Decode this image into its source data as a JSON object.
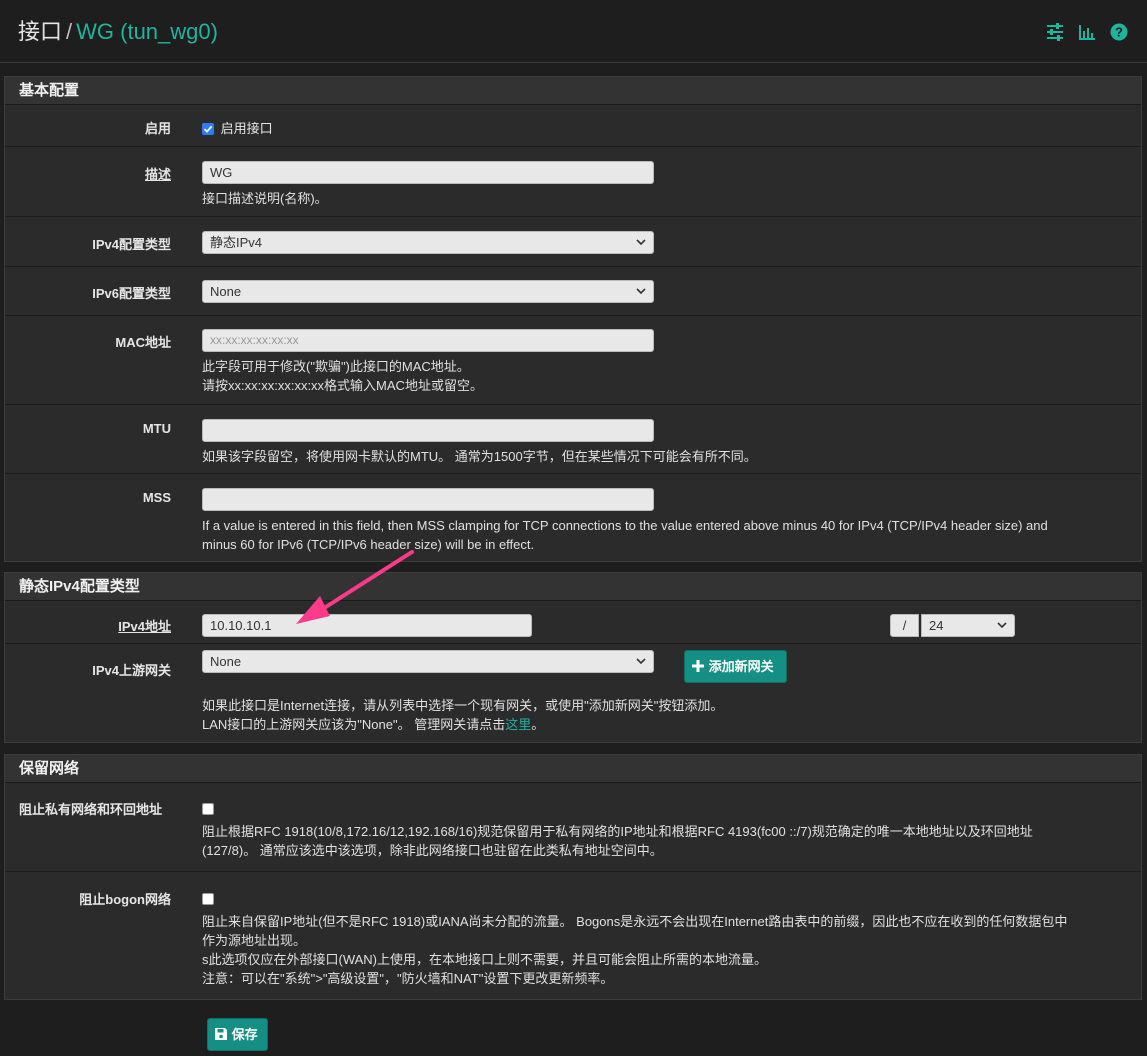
{
  "header": {
    "breadcrumb_root": "接口",
    "breadcrumb_sep": "/",
    "breadcrumb_current": "WG (tun_wg0)",
    "icons": [
      "sliders-icon",
      "bar-chart-icon",
      "help-icon"
    ]
  },
  "basic": {
    "title": "基本配置",
    "enable_label": "启用",
    "enable_checkbox_label": "启用接口",
    "enable_checked": true,
    "desc_label": "描述",
    "desc_value": "WG",
    "desc_help": "接口描述说明(名称)。",
    "ipv4_type_label": "IPv4配置类型",
    "ipv4_type_value": "静态IPv4",
    "ipv6_type_label": "IPv6配置类型",
    "ipv6_type_value": "None",
    "mac_label": "MAC地址",
    "mac_placeholder": "xx:xx:xx:xx:xx:xx",
    "mac_help_1": "此字段可用于修改(\"欺骗\")此接口的MAC地址。",
    "mac_help_2": "请按xx:xx:xx:xx:xx:xx格式输入MAC地址或留空。",
    "mtu_label": "MTU",
    "mtu_help": "如果该字段留空，将使用网卡默认的MTU。 通常为1500字节，但在某些情况下可能会有所不同。",
    "mss_label": "MSS",
    "mss_help_1": "If a value is entered in this field, then MSS clamping for TCP connections to the value entered above minus 40 for IPv4 (TCP/IPv4 header size) and",
    "mss_help_2": "minus 60 for IPv6 (TCP/IPv6 header size) will be in effect."
  },
  "static4": {
    "title": "静态IPv4配置类型",
    "addr_label": "IPv4地址",
    "addr_value": "10.10.10.1",
    "slash": "/",
    "mask_value": "24",
    "gw_label": "IPv4上游网关",
    "gw_value": "None",
    "add_gw_button": "添加新网关",
    "gw_help_1": "如果此接口是Internet连接，请从列表中选择一个现有网关，或使用\"添加新网关\"按钮添加。",
    "gw_help_2a": "LAN接口的上游网关应该为\"None\"。 管理网关请点击",
    "gw_help_link": "这里",
    "gw_help_2b": "。"
  },
  "reserved": {
    "title": "保留网络",
    "private_label": "阻止私有网络和环回地址",
    "private_checked": false,
    "private_help_1": "阻止根据RFC 1918(10/8,172.16/12,192.168/16)规范保留用于私有网络的IP地址和根据RFC 4193(fc00 ::/7)规范确定的唯一本地地址以及环回地址",
    "private_help_2": "(127/8)。 通常应该选中该选项，除非此网络接口也驻留在此类私有地址空间中。",
    "bogon_label": "阻止bogon网络",
    "bogon_checked": false,
    "bogon_help_1": "阻止来自保留IP地址(但不是RFC 1918)或IANA尚未分配的流量。 Bogons是永远不会出现在Internet路由表中的前缀，因此也不应在收到的任何数据包中",
    "bogon_help_2": "作为源地址出现。",
    "bogon_help_3": "s此选项仅应在外部接口(WAN)上使用，在本地接口上则不需要，并且可能会阻止所需的本地流量。",
    "bogon_help_4": "注意：可以在\"系统\">\"高级设置\"，\"防火墙和NAT\"设置下更改更新频率。"
  },
  "footer": {
    "save_button": "保存"
  },
  "colors": {
    "accent": "#1fb3a0",
    "button": "#158e83",
    "annotation_arrow": "#ff3b8a"
  }
}
